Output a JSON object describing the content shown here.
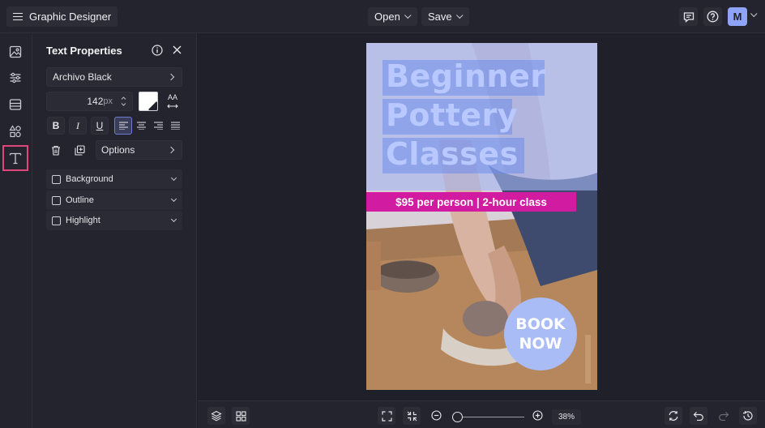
{
  "app": {
    "title": "Graphic Designer",
    "user_initial": "M"
  },
  "toolbar": {
    "open_label": "Open",
    "save_label": "Save"
  },
  "rail": {
    "items": [
      "image-icon",
      "sliders-icon",
      "layout-icon",
      "shapes-icon",
      "text-icon"
    ],
    "active": "text-icon"
  },
  "panel": {
    "title": "Text Properties",
    "font_name": "Archivo Black",
    "font_size": "142",
    "font_size_unit": "px",
    "case_label": "AA",
    "bold_label": "B",
    "italic_label": "I",
    "underline_label": "U",
    "options_label": "Options",
    "sections": [
      {
        "label": "Background"
      },
      {
        "label": "Outline"
      },
      {
        "label": "Highlight"
      }
    ]
  },
  "poster": {
    "title_lines": [
      "Beginner",
      "Pottery",
      "Classes"
    ],
    "price_text": "$95 per person | 2-hour class",
    "cta_line1": "BOOK",
    "cta_line2": "NOW"
  },
  "zoom": {
    "value": "38%"
  },
  "colors": {
    "accent": "#8fa3f8",
    "price_bar": "#d11ba0",
    "title_text": "#b9c9ff",
    "cta_circle": "#a9bcf6",
    "active_rail": "#e0457b"
  }
}
